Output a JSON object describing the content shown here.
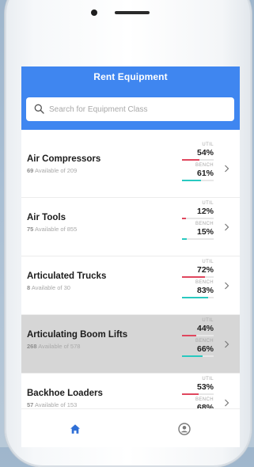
{
  "header": {
    "title": "Rent Equipment"
  },
  "search": {
    "placeholder": "Search for Equipment Class"
  },
  "labels": {
    "util": "UTIL",
    "bench": "BENCH",
    "available_of": "Available of"
  },
  "colors": {
    "header": "#3f86f0",
    "util_bar": "#e0475e",
    "bench_bar": "#29c9c0",
    "selected_row": "#d6d6d6"
  },
  "equipment": [
    {
      "name": "Air Compressors",
      "available": "69",
      "total": "209",
      "util": "54%",
      "bench": "61%",
      "util_value": 54,
      "bench_value": 61,
      "selected": false
    },
    {
      "name": "Air Tools",
      "available": "75",
      "total": "855",
      "util": "12%",
      "bench": "15%",
      "util_value": 12,
      "bench_value": 15,
      "selected": false
    },
    {
      "name": "Articulated Trucks",
      "available": "8",
      "total": "30",
      "util": "72%",
      "bench": "83%",
      "util_value": 72,
      "bench_value": 83,
      "selected": false
    },
    {
      "name": "Articulating Boom Lifts",
      "available": "268",
      "total": "578",
      "util": "44%",
      "bench": "66%",
      "util_value": 44,
      "bench_value": 66,
      "selected": true
    },
    {
      "name": "Backhoe Loaders",
      "available": "57",
      "total": "153",
      "util": "53%",
      "bench": "68%",
      "util_value": 53,
      "bench_value": 68,
      "selected": false
    }
  ],
  "nav": {
    "items": [
      "home-icon",
      "profile-icon"
    ]
  }
}
